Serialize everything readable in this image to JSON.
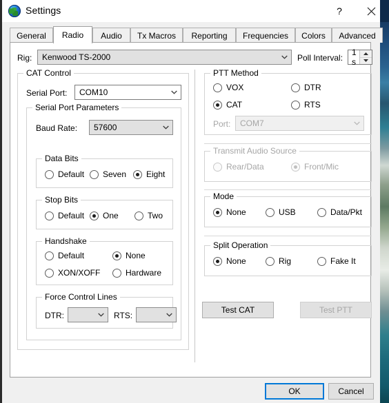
{
  "window": {
    "title": "Settings",
    "icon": "globe-icon",
    "help_label": "?",
    "close_label": "✕"
  },
  "tabs": [
    {
      "label": "General",
      "active": false
    },
    {
      "label": "Radio",
      "active": true
    },
    {
      "label": "Audio",
      "active": false
    },
    {
      "label": "Tx Macros",
      "active": false
    },
    {
      "label": "Reporting",
      "active": false
    },
    {
      "label": "Frequencies",
      "active": false
    },
    {
      "label": "Colors",
      "active": false
    },
    {
      "label": "Advanced",
      "active": false
    }
  ],
  "rig_row": {
    "rig_label": "Rig:",
    "rig_value": "Kenwood TS-2000",
    "poll_label": "Poll Interval:",
    "poll_value": "1 s"
  },
  "cat_control": {
    "title": "CAT Control",
    "serial_port_label": "Serial Port:",
    "serial_port_value": "COM10",
    "params": {
      "title": "Serial Port Parameters",
      "baud_label": "Baud Rate:",
      "baud_value": "57600",
      "data_bits": {
        "title": "Data Bits",
        "options": [
          "Default",
          "Seven",
          "Eight"
        ],
        "selected": "Eight"
      },
      "stop_bits": {
        "title": "Stop Bits",
        "options": [
          "Default",
          "One",
          "Two"
        ],
        "selected": "One"
      },
      "handshake": {
        "title": "Handshake",
        "options": [
          "Default",
          "None",
          "XON/XOFF",
          "Hardware"
        ],
        "selected": "None"
      },
      "force_control_lines": {
        "title": "Force Control Lines",
        "dtr_label": "DTR:",
        "dtr_value": "",
        "rts_label": "RTS:",
        "rts_value": ""
      }
    }
  },
  "ptt_method": {
    "title": "PTT Method",
    "options": [
      "VOX",
      "DTR",
      "CAT",
      "RTS"
    ],
    "selected": "CAT",
    "port_label": "Port:",
    "port_value": "COM7",
    "port_enabled": false
  },
  "transmit_audio_source": {
    "title": "Transmit Audio Source",
    "options": [
      "Rear/Data",
      "Front/Mic"
    ],
    "selected": "Front/Mic",
    "enabled": false
  },
  "mode": {
    "title": "Mode",
    "options": [
      "None",
      "USB",
      "Data/Pkt"
    ],
    "selected": "None"
  },
  "split_operation": {
    "title": "Split Operation",
    "options": [
      "None",
      "Rig",
      "Fake It"
    ],
    "selected": "None"
  },
  "test_buttons": {
    "test_cat": "Test CAT",
    "test_ptt": "Test PTT",
    "test_ptt_enabled": false
  },
  "footer": {
    "ok": "OK",
    "cancel": "Cancel"
  },
  "colors": {
    "accent": "#0078d7",
    "titlebar_strip": "#0d2a4a",
    "disabled_text": "#a6a6a6"
  }
}
